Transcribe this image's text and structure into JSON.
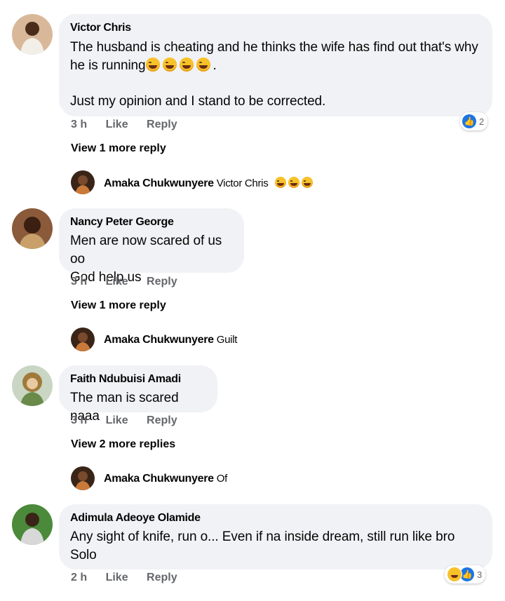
{
  "comments": [
    {
      "author": "Victor Chris",
      "text_line1": "The husband is cheating and he thinks the wife has find out that's why",
      "text_line2": "he is running",
      "text_line2_suffix": ".",
      "text_line3": "Just my opinion and I stand to be corrected.",
      "time": "3 h",
      "like": "Like",
      "reply": "Reply",
      "reaction_count": "2",
      "view_more": "View 1 more reply",
      "reply_author": "Amaka Chukwunyere",
      "reply_text": "Victor Chris"
    },
    {
      "author": "Nancy Peter George",
      "text_line1": "Men are now scared of us oo",
      "text_line2": "God help us",
      "time": "3 h",
      "like": "Like",
      "reply": "Reply",
      "view_more": "View 1 more reply",
      "reply_author": "Amaka Chukwunyere",
      "reply_text": "Guilt"
    },
    {
      "author": "Faith Ndubuisi Amadi",
      "text_line1": "The man is scared naaa",
      "time": "3 h",
      "like": "Like",
      "reply": "Reply",
      "view_more": "View 2 more replies",
      "reply_author": "Amaka Chukwunyere",
      "reply_text": "Of"
    },
    {
      "author": "Adimula Adeoye Olamide",
      "text_line1": "Any sight of knife, run o... Even if na inside dream, still run like bro",
      "text_line2": "Solo",
      "time": "2 h",
      "like": "Like",
      "reply": "Reply",
      "reaction_count": "3"
    }
  ],
  "icons": {
    "like_reaction": "thumbs-up-icon",
    "haha_reaction": "laughing-face-icon",
    "emoji": "rolling-on-floor-laughing-emoji"
  },
  "colors": {
    "bubble": "#f0f2f5",
    "meta": "#65676b",
    "like_blue": "#1b74e4"
  }
}
